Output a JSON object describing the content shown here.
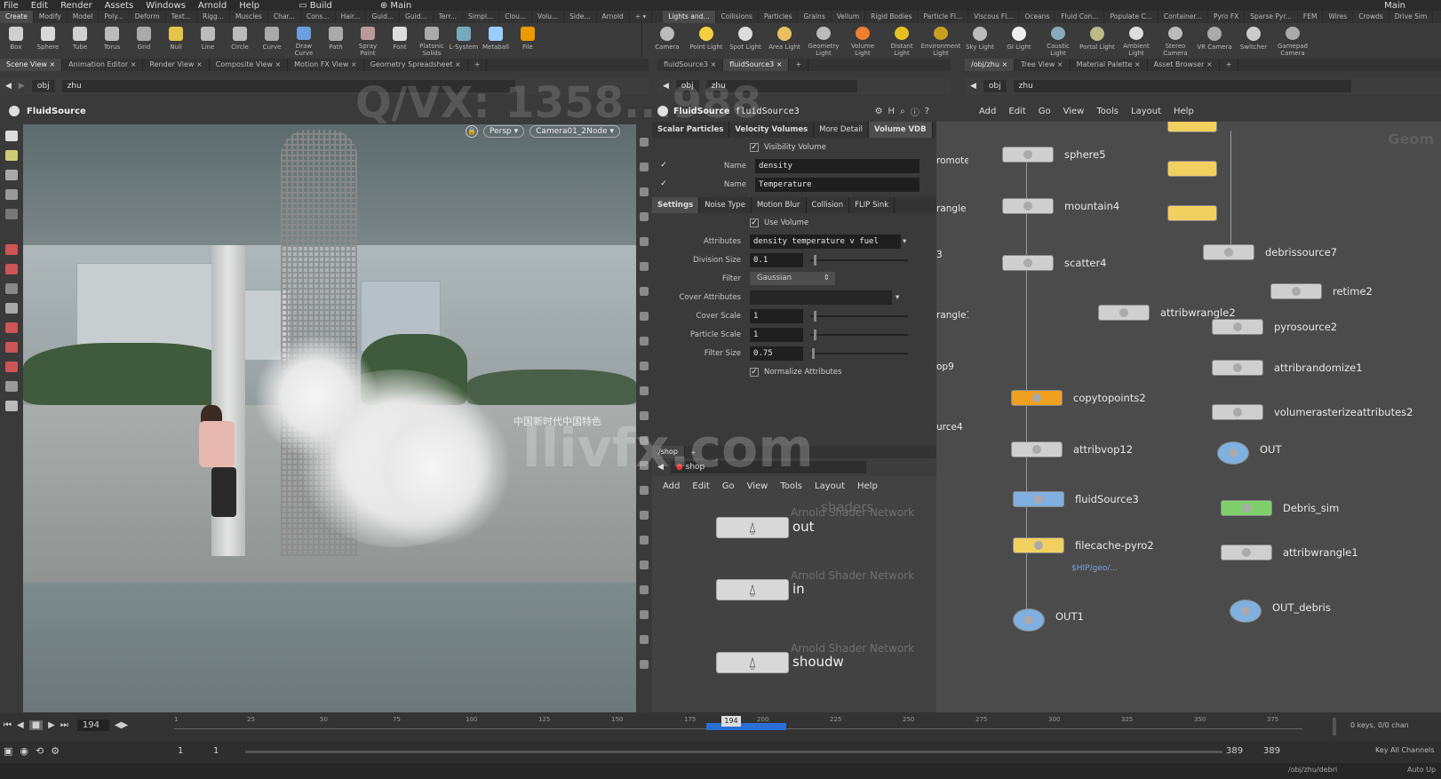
{
  "menubar": {
    "items": [
      "File",
      "Edit",
      "Render",
      "Assets",
      "Windows",
      "Arnold",
      "Help"
    ],
    "desktop": "Build",
    "desktop_right": "Main",
    "main_label": "Main"
  },
  "shelf_tabs_left": [
    "Create",
    "Modify",
    "Model",
    "Poly...",
    "Deform",
    "Text...",
    "Rigg...",
    "Muscles",
    "Char...",
    "Cons...",
    "Hair...",
    "Guid...",
    "Guid...",
    "Terr...",
    "Simpl...",
    "Clou...",
    "Volu...",
    "Side...",
    "Arnold"
  ],
  "shelf_tabs_right": [
    "Lights and...",
    "Collisions",
    "Particles",
    "Grains",
    "Vellum",
    "Rigid Bodies",
    "Particle Fl...",
    "Viscous Fl...",
    "Oceans",
    "Fluid Con...",
    "Populate C...",
    "Container...",
    "Pyro FX",
    "Sparse Pyr...",
    "FEM",
    "Wires",
    "Crowds",
    "Drive Sim"
  ],
  "shelf_tools_left": [
    "Box",
    "Sphere",
    "Tube",
    "Torus",
    "Grid",
    "Null",
    "Line",
    "Circle",
    "Curve",
    "Draw Curve",
    "Path",
    "Spray Paint",
    "Font",
    "Platonic Solids",
    "L-System",
    "Metaball",
    "File"
  ],
  "shelf_tools_right": [
    "Camera",
    "Point Light",
    "Spot Light",
    "Area Light",
    "Geometry Light",
    "Volume Light",
    "Distant Light",
    "Environment Light",
    "Sky Light",
    "GI Light",
    "Caustic Light",
    "Portal Light",
    "Ambient Light",
    "Stereo Camera",
    "VR Camera",
    "Switcher",
    "Gamepad Camera"
  ],
  "pane_tabs_left": [
    "Scene View",
    "Animation Editor",
    "Render View",
    "Composite View",
    "Motion FX View",
    "Geometry Spreadsheet"
  ],
  "pane_tabs_mid": [
    "fluidSource3",
    "fluidSource3"
  ],
  "pane_tabs_right": [
    "/obj/zhu",
    "Tree View",
    "Material Palette",
    "Asset Browser"
  ],
  "path_left": {
    "obj": "obj",
    "node": "zhu"
  },
  "path_mid": {
    "obj": "obj",
    "node": "zhu"
  },
  "path_right": {
    "obj": "obj",
    "node": "zhu"
  },
  "viewport": {
    "title": "FluidSource",
    "persp": "Persp",
    "camera": "Camera01_2Node",
    "chinese_overlay": "Q/VX: 1358...988",
    "caption": "中国新时代中国特色"
  },
  "params": {
    "node_type": "FluidSource",
    "node_name": "fluidSource3",
    "tabs": [
      "Scalar Particles",
      "Velocity Volumes",
      "More Detail",
      "Volume VDB"
    ],
    "visibility_volume_label": "Visibility Volume",
    "name1_label": "Name",
    "name1_value": "density",
    "name2_label": "Name",
    "name2_value": "Temperature",
    "subtabs": [
      "Settings",
      "Noise Type",
      "Motion Blur",
      "Collision",
      "FLIP Sink"
    ],
    "use_volume_label": "Use Volume",
    "attributes_label": "Attributes",
    "attributes_value": "density temperature v fuel",
    "division_size_label": "Division Size",
    "division_size_value": "0.1",
    "filter_label": "Filter",
    "filter_value": "Gaussian",
    "cover_attributes_label": "Cover Attributes",
    "cover_attributes_value": "",
    "cover_scale_label": "Cover Scale",
    "cover_scale_value": "1",
    "particle_scale_label": "Particle Scale",
    "particle_scale_value": "1",
    "filter_size_label": "Filter Size",
    "filter_size_value": "0.75",
    "normalize_label": "Normalize Attributes"
  },
  "shop": {
    "tab": "/shop",
    "path": "shop",
    "menu": [
      "Add",
      "Edit",
      "Go",
      "View",
      "Tools",
      "Layout",
      "Help"
    ],
    "section": "shaders",
    "nodes": [
      {
        "type": "Arnold Shader Network",
        "name": "out"
      },
      {
        "type": "Arnold Shader Network",
        "name": "in"
      },
      {
        "type": "Arnold Shader Network",
        "name": "shoudw"
      }
    ]
  },
  "network": {
    "menu": [
      "Add",
      "Edit",
      "Go",
      "View",
      "Tools",
      "Layout",
      "Help"
    ],
    "context_label": "Geom",
    "left_fragments": [
      "romote",
      "rangle",
      "3",
      "rangle14",
      "op9",
      "urce4"
    ],
    "col1": [
      "sphere5",
      "mountain4",
      "scatter4",
      "attribwrangle2",
      "copytopoints2",
      "attribvop12",
      "fluidSource3",
      "filecache-pyro2",
      "OUT1"
    ],
    "file_path": "$HIP/geo/...",
    "col2": [
      "debrissource7",
      "retime2",
      "pyrosource2",
      "attribrandomize1",
      "volumerasterizeattributes2",
      "OUT",
      "Debris_sim",
      "attribwrangle1",
      "OUT_debris"
    ]
  },
  "timeline": {
    "current_frame": "194",
    "ticks": [
      "1",
      "25",
      "50",
      "75",
      "100",
      "125",
      "150",
      "175",
      "200",
      "225",
      "250",
      "275",
      "300",
      "325",
      "350",
      "375"
    ],
    "start": "1",
    "start2": "1",
    "end": "389",
    "end2": "389",
    "keys_info": "0 keys, 0/0 chan",
    "key_all": "Key All Channels",
    "status_path": "/obj/zhu/debri",
    "auto_update": "Auto Up"
  },
  "watermark": {
    "text": "llivfx.com"
  },
  "colors": {
    "bg": "#3a3a3a",
    "node_orange": "#f0a020",
    "node_yellow": "#f2d060",
    "node_green": "#7fd06a",
    "node_blue": "#7fb0e0",
    "timeline_highlight": "#2a6fd6"
  }
}
